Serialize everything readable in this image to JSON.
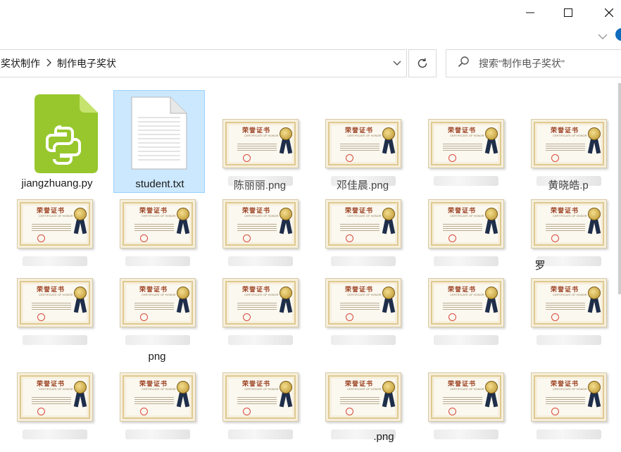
{
  "window": {
    "controls": {
      "minimize": "minimize",
      "maximize": "maximize",
      "close": "close"
    }
  },
  "address": {
    "crumbs": [
      "奖状制作",
      "制作电子奖状"
    ],
    "separator_icon": "chevron-right-icon"
  },
  "search": {
    "placeholder": "搜索\"制作电子奖状\""
  },
  "files": {
    "python": {
      "name": "jiangzhuang.py",
      "icon": "python-file-icon"
    },
    "text": {
      "name": "student.txt",
      "icon": "text-file-icon",
      "selected": true
    },
    "png_suffix": "png",
    "certificate": {
      "title": "荣誉证书",
      "subtitle": "CERTIFICATE OF HONOR"
    },
    "partial_labels": [
      "陈丽丽.png",
      "邓佳晨.png",
      "黄晓皓.p",
      "罗",
      "png",
      ".png"
    ]
  },
  "colors": {
    "selection_bg": "#cce8ff",
    "selection_border": "#99d1ff",
    "python_green": "#97c72d"
  }
}
